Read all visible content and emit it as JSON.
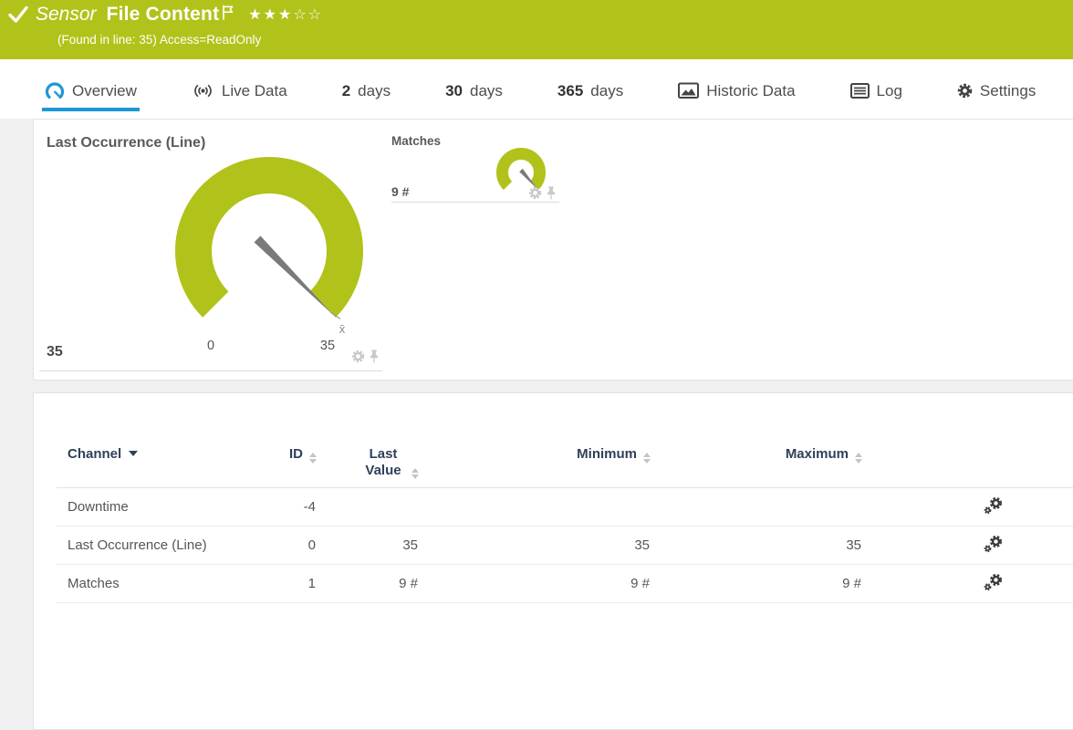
{
  "colors": {
    "brand_green": "#b1c31a",
    "accent_blue": "#1e97d5",
    "gauge_green": "#b1c31a"
  },
  "header": {
    "type_label": "Sensor",
    "title": "File Content",
    "rating_stars": "★★★☆☆",
    "subtitle": "(Found in line: 35) Access=ReadOnly"
  },
  "tabs": {
    "overview": "Overview",
    "live_data": "Live Data",
    "days2_value": "2",
    "days2_label": "days",
    "days30_value": "30",
    "days30_label": "days",
    "days365_value": "365",
    "days365_label": "days",
    "historic_data": "Historic Data",
    "log": "Log",
    "settings": "Settings"
  },
  "gauges": {
    "primary": {
      "title": "Last Occurrence (Line)",
      "value": "35",
      "scale_min": "0",
      "scale_max": "35",
      "avg_marker": "x̄"
    },
    "secondary": {
      "title": "Matches",
      "value": "9 #"
    }
  },
  "channel_table": {
    "headers": {
      "channel": "Channel",
      "id": "ID",
      "last_value": "Last Value",
      "minimum": "Minimum",
      "maximum": "Maximum"
    },
    "rows": [
      {
        "channel": "Downtime",
        "id": "-4",
        "last_value": "",
        "minimum": "",
        "maximum": ""
      },
      {
        "channel": "Last Occurrence (Line)",
        "id": "0",
        "last_value": "35",
        "minimum": "35",
        "maximum": "35"
      },
      {
        "channel": "Matches",
        "id": "1",
        "last_value": "9 #",
        "minimum": "9 #",
        "maximum": "9 #"
      }
    ]
  }
}
